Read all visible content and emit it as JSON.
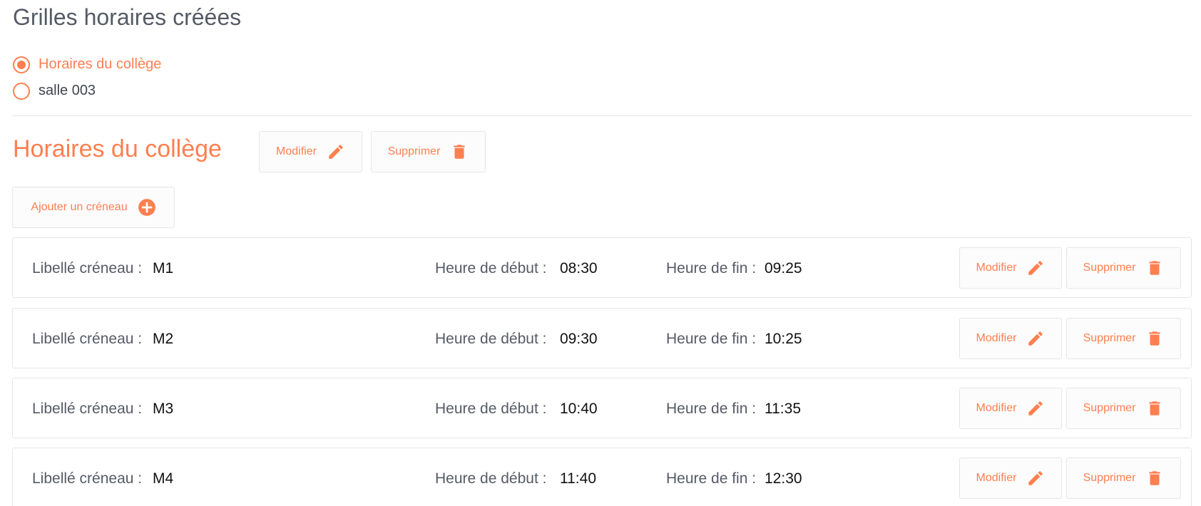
{
  "header": {
    "title": "Grilles horaires créées"
  },
  "grids": [
    {
      "label": "Horaires du collège",
      "selected": true
    },
    {
      "label": "salle 003",
      "selected": false
    }
  ],
  "selected_grid": {
    "title": "Horaires du collège",
    "edit_label": "Modifier",
    "delete_label": "Supprimer",
    "add_slot_label": "Ajouter un créneau"
  },
  "slot_labels": {
    "name": "Libellé créneau :",
    "start": "Heure de début :",
    "end": "Heure de fin :",
    "edit": "Modifier",
    "delete": "Supprimer"
  },
  "slots": [
    {
      "name": "M1",
      "start": "08:30",
      "end": "09:25"
    },
    {
      "name": "M2",
      "start": "09:30",
      "end": "10:25"
    },
    {
      "name": "M3",
      "start": "10:40",
      "end": "11:35"
    },
    {
      "name": "M4",
      "start": "11:40",
      "end": "12:30"
    }
  ],
  "colors": {
    "accent": "#ff7f50",
    "text": "#555b66",
    "border": "#e6e6e6"
  },
  "icons": {
    "edit": "pencil-icon",
    "delete": "trash-icon",
    "add": "plus-circle-icon"
  }
}
